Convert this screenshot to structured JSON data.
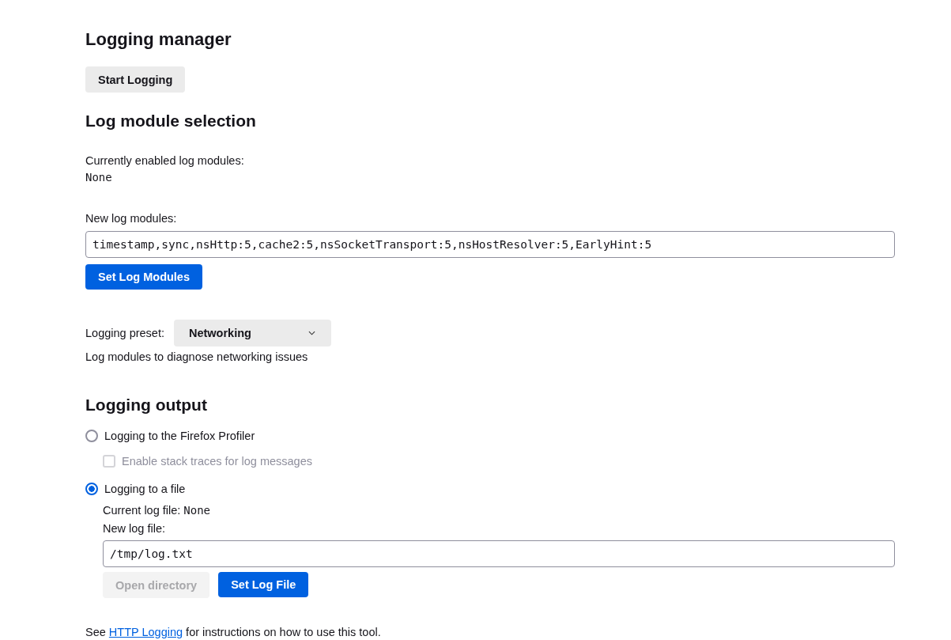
{
  "title": "Logging manager",
  "start_button": "Start Logging",
  "module_section": {
    "heading": "Log module selection",
    "current_label": "Currently enabled log modules:",
    "current_value": "None",
    "new_label": "New log modules:",
    "new_value": "timestamp,sync,nsHttp:5,cache2:5,nsSocketTransport:5,nsHostResolver:5,EarlyHint:5",
    "set_button": "Set Log Modules"
  },
  "preset": {
    "label": "Logging preset:",
    "value": "Networking",
    "description": "Log modules to diagnose networking issues"
  },
  "output_section": {
    "heading": "Logging output",
    "options": [
      {
        "kind": "radio",
        "label": "Logging to the Firefox Profiler",
        "selected": false
      },
      {
        "kind": "checkbox",
        "label": "Enable stack traces for log messages",
        "checked": false,
        "disabled": true
      },
      {
        "kind": "radio",
        "label": "Logging to a file",
        "selected": true
      }
    ],
    "current_file_label": "Current log file:",
    "current_file_value": "None",
    "new_file_label": "New log file:",
    "new_file_value": "/tmp/log.txt",
    "buttons": [
      {
        "label": "Open directory",
        "disabled": true,
        "primary": false
      },
      {
        "label": "Set Log File",
        "disabled": false,
        "primary": true
      }
    ]
  },
  "footer": {
    "before": "See ",
    "link": "HTTP Logging",
    "after": " for instructions on how to use this tool."
  }
}
